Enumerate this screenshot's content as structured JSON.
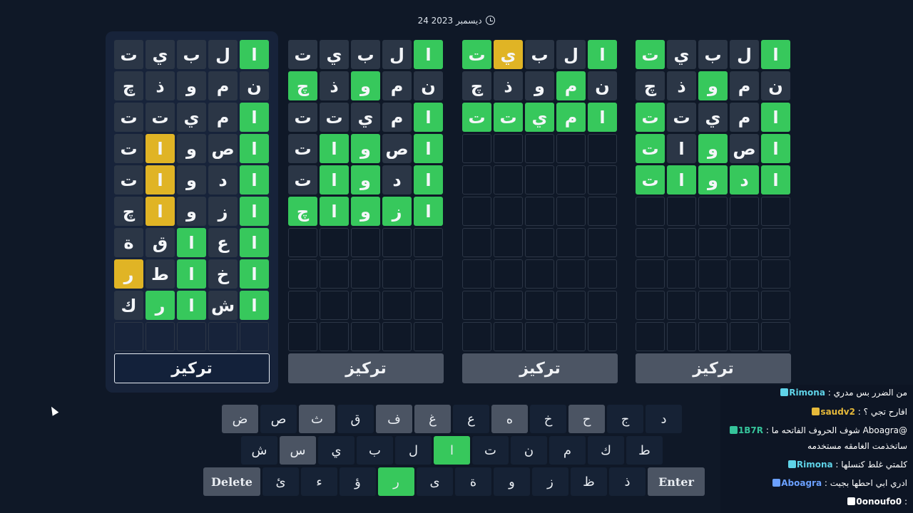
{
  "date_label": "24 ديسمبر 2023",
  "focus_label": "تركيز",
  "boards": [
    {
      "active": true,
      "rows": [
        [
          [
            "ا",
            "g"
          ],
          [
            "ل",
            "x"
          ],
          [
            "ب",
            "x"
          ],
          [
            "ي",
            "x"
          ],
          [
            "ت",
            "x"
          ]
        ],
        [
          [
            "ن",
            "x"
          ],
          [
            "م",
            "x"
          ],
          [
            "و",
            "x"
          ],
          [
            "ذ",
            "x"
          ],
          [
            "چ",
            "x"
          ]
        ],
        [
          [
            "ا",
            "g"
          ],
          [
            "م",
            "x"
          ],
          [
            "ي",
            "x"
          ],
          [
            "ت",
            "x"
          ],
          [
            "ت",
            "x"
          ]
        ],
        [
          [
            "ا",
            "g"
          ],
          [
            "ص",
            "x"
          ],
          [
            "و",
            "x"
          ],
          [
            "ا",
            "y"
          ],
          [
            "ت",
            "x"
          ]
        ],
        [
          [
            "ا",
            "g"
          ],
          [
            "د",
            "x"
          ],
          [
            "و",
            "x"
          ],
          [
            "ا",
            "y"
          ],
          [
            "ت",
            "x"
          ]
        ],
        [
          [
            "ا",
            "g"
          ],
          [
            "ز",
            "x"
          ],
          [
            "و",
            "x"
          ],
          [
            "ا",
            "y"
          ],
          [
            "چ",
            "x"
          ]
        ],
        [
          [
            "ا",
            "g"
          ],
          [
            "ع",
            "x"
          ],
          [
            "ا",
            "g"
          ],
          [
            "ق",
            "x"
          ],
          [
            "ة",
            "x"
          ]
        ],
        [
          [
            "ا",
            "g"
          ],
          [
            "خ",
            "x"
          ],
          [
            "ا",
            "g"
          ],
          [
            "ط",
            "x"
          ],
          [
            "ر",
            "y"
          ]
        ],
        [
          [
            "ا",
            "g"
          ],
          [
            "ش",
            "x"
          ],
          [
            "ا",
            "g"
          ],
          [
            "ر",
            "g"
          ],
          [
            "ك",
            "x"
          ]
        ],
        [
          [
            "",
            "e"
          ],
          [
            "",
            "e"
          ],
          [
            "",
            "e"
          ],
          [
            "",
            "e"
          ],
          [
            "",
            "e"
          ]
        ]
      ]
    },
    {
      "active": false,
      "rows": [
        [
          [
            "ا",
            "g"
          ],
          [
            "ل",
            "x"
          ],
          [
            "ب",
            "x"
          ],
          [
            "ي",
            "x"
          ],
          [
            "ت",
            "x"
          ]
        ],
        [
          [
            "ن",
            "x"
          ],
          [
            "م",
            "x"
          ],
          [
            "و",
            "g"
          ],
          [
            "ذ",
            "x"
          ],
          [
            "چ",
            "g"
          ]
        ],
        [
          [
            "ا",
            "g"
          ],
          [
            "م",
            "x"
          ],
          [
            "ي",
            "x"
          ],
          [
            "ت",
            "x"
          ],
          [
            "ت",
            "x"
          ]
        ],
        [
          [
            "ا",
            "g"
          ],
          [
            "ص",
            "x"
          ],
          [
            "و",
            "g"
          ],
          [
            "ا",
            "g"
          ],
          [
            "ت",
            "x"
          ]
        ],
        [
          [
            "ا",
            "g"
          ],
          [
            "د",
            "x"
          ],
          [
            "و",
            "g"
          ],
          [
            "ا",
            "g"
          ],
          [
            "ت",
            "x"
          ]
        ],
        [
          [
            "ا",
            "g"
          ],
          [
            "ز",
            "g"
          ],
          [
            "و",
            "g"
          ],
          [
            "ا",
            "g"
          ],
          [
            "چ",
            "g"
          ]
        ],
        [
          [
            "",
            "e"
          ],
          [
            "",
            "e"
          ],
          [
            "",
            "e"
          ],
          [
            "",
            "e"
          ],
          [
            "",
            "e"
          ]
        ],
        [
          [
            "",
            "e"
          ],
          [
            "",
            "e"
          ],
          [
            "",
            "e"
          ],
          [
            "",
            "e"
          ],
          [
            "",
            "e"
          ]
        ],
        [
          [
            "",
            "e"
          ],
          [
            "",
            "e"
          ],
          [
            "",
            "e"
          ],
          [
            "",
            "e"
          ],
          [
            "",
            "e"
          ]
        ],
        [
          [
            "",
            "e"
          ],
          [
            "",
            "e"
          ],
          [
            "",
            "e"
          ],
          [
            "",
            "e"
          ],
          [
            "",
            "e"
          ]
        ]
      ]
    },
    {
      "active": false,
      "rows": [
        [
          [
            "ا",
            "g"
          ],
          [
            "ل",
            "x"
          ],
          [
            "ب",
            "x"
          ],
          [
            "ي",
            "y"
          ],
          [
            "ت",
            "g"
          ]
        ],
        [
          [
            "ن",
            "x"
          ],
          [
            "م",
            "g"
          ],
          [
            "و",
            "x"
          ],
          [
            "ذ",
            "x"
          ],
          [
            "چ",
            "x"
          ]
        ],
        [
          [
            "ا",
            "g"
          ],
          [
            "م",
            "g"
          ],
          [
            "ي",
            "g"
          ],
          [
            "ت",
            "g"
          ],
          [
            "ت",
            "g"
          ]
        ],
        [
          [
            "",
            "e"
          ],
          [
            "",
            "e"
          ],
          [
            "",
            "e"
          ],
          [
            "",
            "e"
          ],
          [
            "",
            "e"
          ]
        ],
        [
          [
            "",
            "e"
          ],
          [
            "",
            "e"
          ],
          [
            "",
            "e"
          ],
          [
            "",
            "e"
          ],
          [
            "",
            "e"
          ]
        ],
        [
          [
            "",
            "e"
          ],
          [
            "",
            "e"
          ],
          [
            "",
            "e"
          ],
          [
            "",
            "e"
          ],
          [
            "",
            "e"
          ]
        ],
        [
          [
            "",
            "e"
          ],
          [
            "",
            "e"
          ],
          [
            "",
            "e"
          ],
          [
            "",
            "e"
          ],
          [
            "",
            "e"
          ]
        ],
        [
          [
            "",
            "e"
          ],
          [
            "",
            "e"
          ],
          [
            "",
            "e"
          ],
          [
            "",
            "e"
          ],
          [
            "",
            "e"
          ]
        ],
        [
          [
            "",
            "e"
          ],
          [
            "",
            "e"
          ],
          [
            "",
            "e"
          ],
          [
            "",
            "e"
          ],
          [
            "",
            "e"
          ]
        ],
        [
          [
            "",
            "e"
          ],
          [
            "",
            "e"
          ],
          [
            "",
            "e"
          ],
          [
            "",
            "e"
          ],
          [
            "",
            "e"
          ]
        ]
      ]
    },
    {
      "active": false,
      "rows": [
        [
          [
            "ا",
            "g"
          ],
          [
            "ل",
            "x"
          ],
          [
            "ب",
            "x"
          ],
          [
            "ي",
            "x"
          ],
          [
            "ت",
            "g"
          ]
        ],
        [
          [
            "ن",
            "x"
          ],
          [
            "م",
            "x"
          ],
          [
            "و",
            "g"
          ],
          [
            "ذ",
            "x"
          ],
          [
            "چ",
            "x"
          ]
        ],
        [
          [
            "ا",
            "g"
          ],
          [
            "م",
            "x"
          ],
          [
            "ي",
            "x"
          ],
          [
            "ت",
            "x"
          ],
          [
            "ت",
            "g"
          ]
        ],
        [
          [
            "ا",
            "g"
          ],
          [
            "ص",
            "x"
          ],
          [
            "و",
            "g"
          ],
          [
            "ا",
            "x"
          ],
          [
            "ت",
            "g"
          ]
        ],
        [
          [
            "ا",
            "g"
          ],
          [
            "د",
            "g"
          ],
          [
            "و",
            "g"
          ],
          [
            "ا",
            "g"
          ],
          [
            "ت",
            "g"
          ]
        ],
        [
          [
            "",
            "e"
          ],
          [
            "",
            "e"
          ],
          [
            "",
            "e"
          ],
          [
            "",
            "e"
          ],
          [
            "",
            "e"
          ]
        ],
        [
          [
            "",
            "e"
          ],
          [
            "",
            "e"
          ],
          [
            "",
            "e"
          ],
          [
            "",
            "e"
          ],
          [
            "",
            "e"
          ]
        ],
        [
          [
            "",
            "e"
          ],
          [
            "",
            "e"
          ],
          [
            "",
            "e"
          ],
          [
            "",
            "e"
          ],
          [
            "",
            "e"
          ]
        ],
        [
          [
            "",
            "e"
          ],
          [
            "",
            "e"
          ],
          [
            "",
            "e"
          ],
          [
            "",
            "e"
          ],
          [
            "",
            "e"
          ]
        ],
        [
          [
            "",
            "e"
          ],
          [
            "",
            "e"
          ],
          [
            "",
            "e"
          ],
          [
            "",
            "e"
          ],
          [
            "",
            "e"
          ]
        ]
      ]
    }
  ],
  "keyboard": {
    "row1": [
      [
        "ض",
        "u"
      ],
      [
        "ص",
        "n"
      ],
      [
        "ث",
        "u"
      ],
      [
        "ق",
        "n"
      ],
      [
        "ف",
        "u"
      ],
      [
        "غ",
        "u"
      ],
      [
        "ع",
        "n"
      ],
      [
        "ه",
        "u"
      ],
      [
        "خ",
        "n"
      ],
      [
        "ح",
        "u"
      ],
      [
        "ج",
        "n"
      ],
      [
        "د",
        "n"
      ]
    ],
    "row2": [
      [
        "ش",
        "n"
      ],
      [
        "س",
        "u"
      ],
      [
        "ي",
        "n"
      ],
      [
        "ب",
        "n"
      ],
      [
        "ل",
        "n"
      ],
      [
        "ا",
        "g"
      ],
      [
        "ت",
        "n"
      ],
      [
        "ن",
        "n"
      ],
      [
        "م",
        "n"
      ],
      [
        "ك",
        "n"
      ],
      [
        "ط",
        "n"
      ]
    ],
    "row3": [
      [
        "Delete",
        "a"
      ],
      [
        "ئ",
        "n"
      ],
      [
        "ء",
        "n"
      ],
      [
        "ؤ",
        "n"
      ],
      [
        "ر",
        "g"
      ],
      [
        "ى",
        "n"
      ],
      [
        "ة",
        "n"
      ],
      [
        "و",
        "n"
      ],
      [
        "ز",
        "n"
      ],
      [
        "ظ",
        "n"
      ],
      [
        "ذ",
        "n"
      ],
      [
        "Enter",
        "a"
      ]
    ]
  },
  "chat": [
    {
      "user": "Rimona",
      "text": "من الضرر بس مدري",
      "color": "#5fd3e8"
    },
    {
      "user": "saudv2",
      "text": "افارح تجي ؟",
      "color": "#e6b93a"
    },
    {
      "user": "1B7R",
      "text": "@Aboagra شوف الحروف الفاتحه ما",
      "color": "#35c39a"
    },
    {
      "user": "",
      "text": "ساتخذمت الغامقه مستخدمه",
      "color": "#ffffff"
    },
    {
      "user": "Rimona",
      "text": "كلمتي غلط كنسلها",
      "color": "#5fd3e8"
    },
    {
      "user": "Aboagra",
      "text": "ادري ابي احطها بجيت",
      "color": "#6ba0ff"
    },
    {
      "user": "0onoufo0",
      "text": "",
      "color": "#ffffff"
    }
  ]
}
